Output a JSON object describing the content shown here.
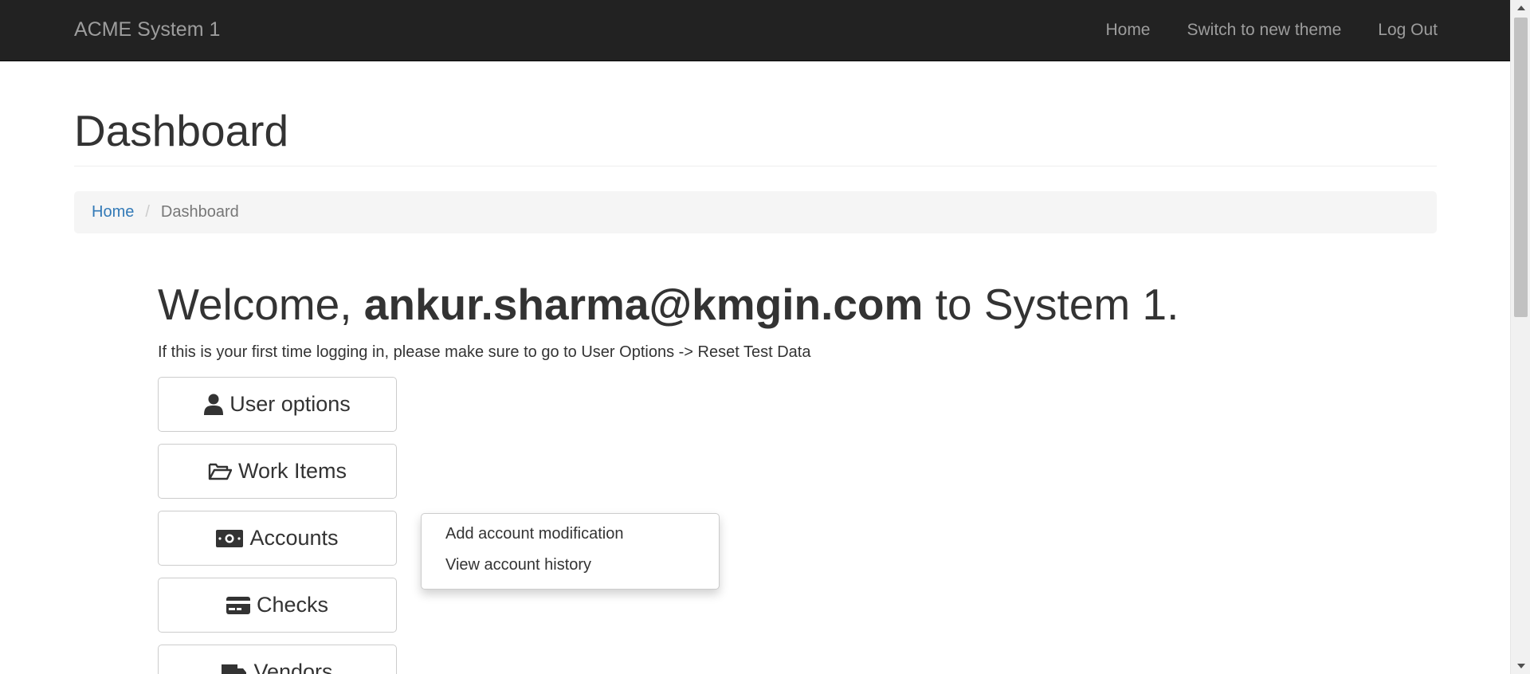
{
  "navbar": {
    "brand": "ACME System 1",
    "links": [
      "Home",
      "Switch to new theme",
      "Log Out"
    ]
  },
  "page": {
    "title": "Dashboard"
  },
  "breadcrumb": {
    "home": "Home",
    "separator": "/",
    "current": "Dashboard"
  },
  "welcome": {
    "prefix": "Welcome, ",
    "user": "ankur.sharma@kmgin.com",
    "suffix": " to System 1."
  },
  "hint": "If this is your first time logging in, please make sure to go to User Options -> Reset Test Data",
  "buttons": [
    {
      "label": "User options",
      "icon": "user-icon"
    },
    {
      "label": "Work Items",
      "icon": "folder-open-icon"
    },
    {
      "label": "Accounts",
      "icon": "money-icon"
    },
    {
      "label": "Checks",
      "icon": "credit-card-icon"
    },
    {
      "label": "Vendors",
      "icon": "truck-icon"
    }
  ],
  "accounts_menu": {
    "items": [
      "Add account modification",
      "View account history"
    ]
  },
  "colors": {
    "navbar_bg": "#222222",
    "link": "#337ab7",
    "breadcrumb_bg": "#f5f5f5"
  }
}
